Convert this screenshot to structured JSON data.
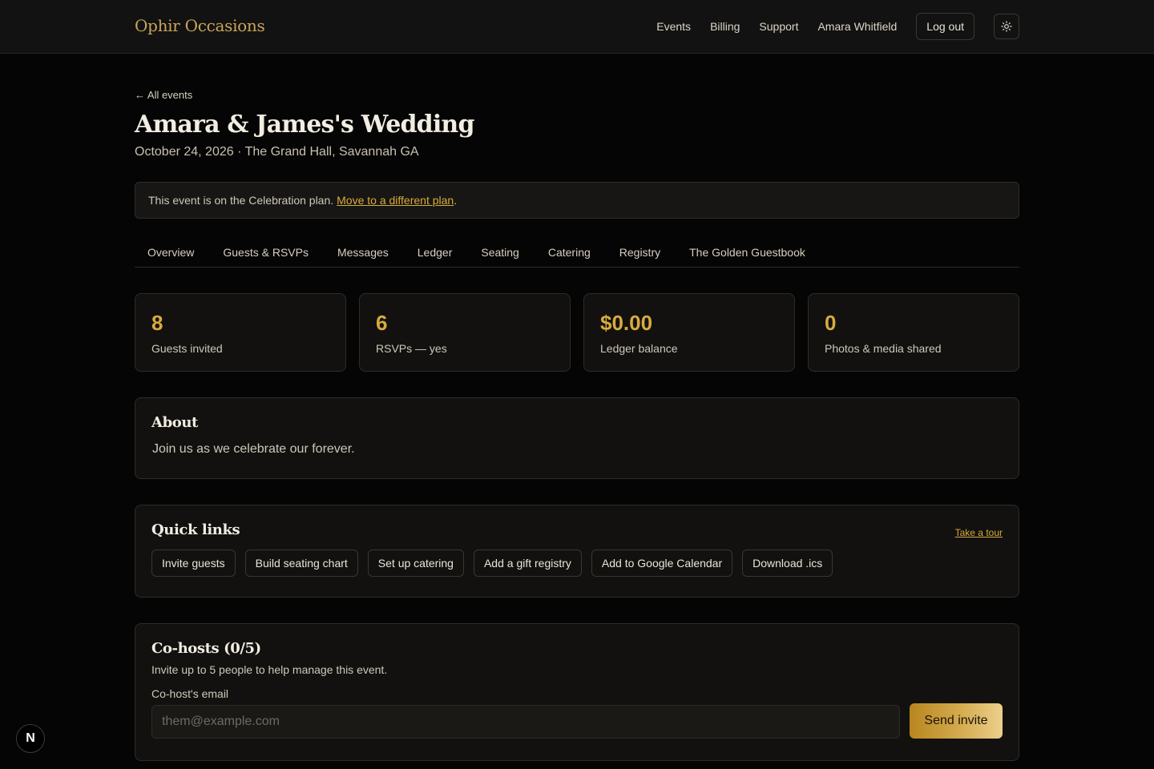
{
  "header": {
    "brand": "Ophir Occasions",
    "nav": [
      "Events",
      "Billing",
      "Support",
      "Amara Whitfield"
    ],
    "logout": "Log out",
    "theme_icon": "sun-icon"
  },
  "event": {
    "back": "← All events",
    "title": "Amara & James's Wedding",
    "subtitle": "October 24, 2026 · The Grand Hall, Savannah GA"
  },
  "plan": {
    "text": "This event is on the Celebration plan.",
    "link": "Move to a different plan",
    "suffix": "."
  },
  "tabs": [
    "Overview",
    "Guests & RSVPs",
    "Messages",
    "Ledger",
    "Seating",
    "Catering",
    "Registry",
    "The Golden Guestbook"
  ],
  "stats": [
    {
      "value": "8",
      "label": "Guests invited"
    },
    {
      "value": "6",
      "label": "RSVPs — yes"
    },
    {
      "value": "$0.00",
      "label": "Ledger balance"
    },
    {
      "value": "0",
      "label": "Photos & media shared"
    }
  ],
  "about": {
    "title": "About",
    "text": "Join us as we celebrate our forever."
  },
  "quick_links": {
    "title": "Quick links",
    "tour": "Take a tour",
    "items": [
      "Invite guests",
      "Build seating chart",
      "Set up catering",
      "Add a gift registry",
      "Add to Google Calendar",
      "Download .ics"
    ]
  },
  "cohosts": {
    "title": "Co-hosts (0/5)",
    "description": "Invite up to 5 people to help manage this event.",
    "email_label": "Co-host's email",
    "email_placeholder": "them@example.com",
    "send": "Send invite"
  },
  "badge": "N",
  "colors": {
    "accent": "#d8ab3c",
    "background": "#050505",
    "card": "#121110"
  }
}
